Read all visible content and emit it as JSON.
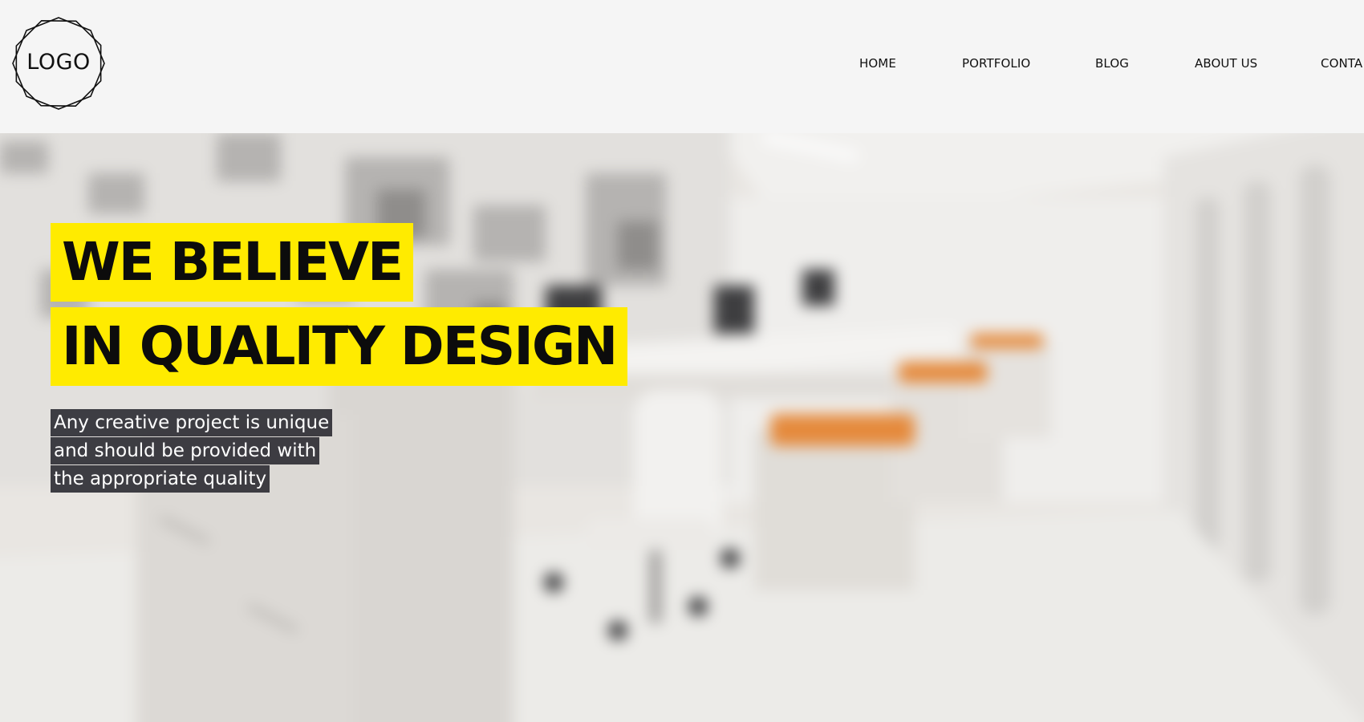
{
  "header": {
    "logo_text": "LOGO",
    "nav": [
      {
        "label": "HOME"
      },
      {
        "label": "PORTFOLIO"
      },
      {
        "label": "BLOG"
      },
      {
        "label": "ABOUT US"
      },
      {
        "label": "CONTA"
      }
    ]
  },
  "hero": {
    "headline_lines": [
      "WE BELIEVE",
      "IN QUALITY DESIGN"
    ],
    "subtext_lines": [
      "Any creative project is unique",
      "and should be provided with",
      "the appropriate quality"
    ],
    "background_image": "blurred-office-interior",
    "accent_color": "#ffeb00",
    "subtext_background": "#34343a"
  }
}
